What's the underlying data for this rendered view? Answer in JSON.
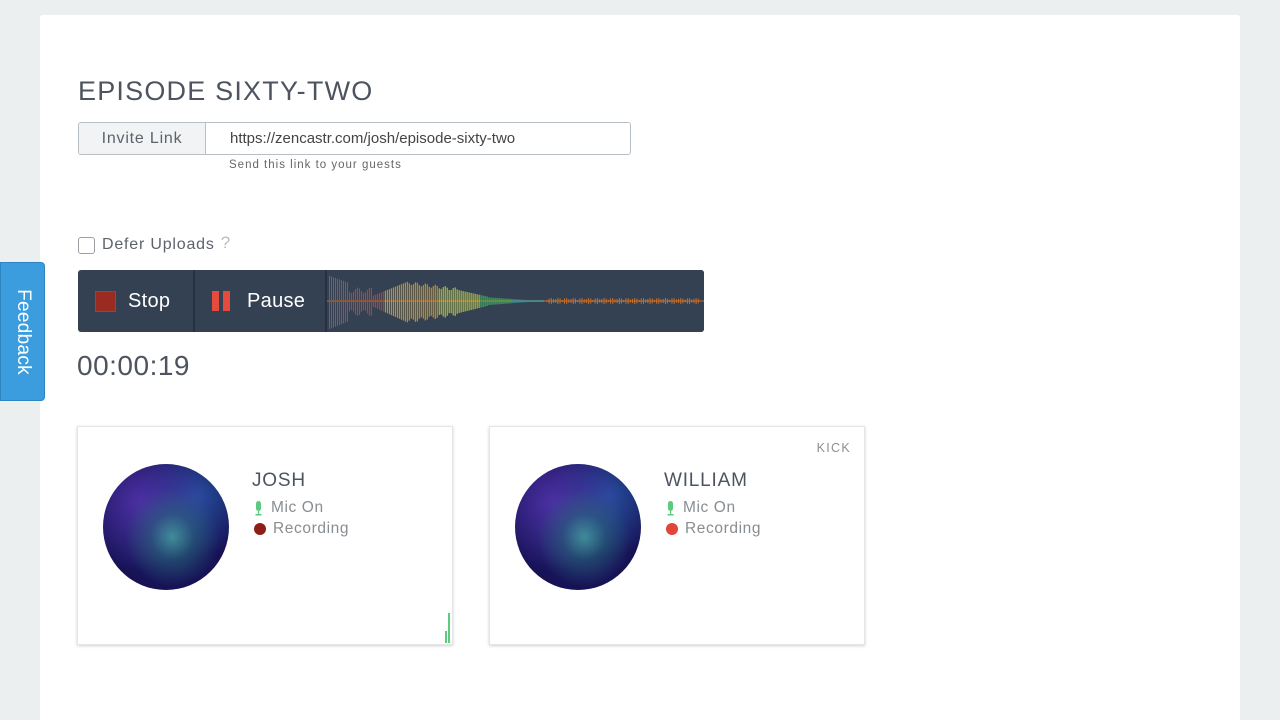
{
  "feedback": {
    "label": "Feedback"
  },
  "episode": {
    "title": "EPISODE SIXTY-TWO"
  },
  "invite": {
    "label": "Invite Link",
    "url": "https://zencastr.com/josh/episode-sixty-two",
    "hint": "Send this link to your guests"
  },
  "options": {
    "defer_label": "Defer Uploads",
    "defer_checked": false,
    "help": "?"
  },
  "controls": {
    "stop_label": "Stop",
    "pause_label": "Pause"
  },
  "timer": {
    "elapsed": "00:00:19"
  },
  "participants": [
    {
      "name": "JOSH",
      "mic_status": "Mic On",
      "rec_status": "Recording",
      "rec_color": "#8f1f16",
      "kick": ""
    },
    {
      "name": "WILLIAM",
      "mic_status": "Mic On",
      "rec_status": "Recording",
      "rec_color": "#e0443a",
      "kick": "KICK"
    }
  ],
  "colors": {
    "accent": "#3b9ddd",
    "toolbar": "#334152",
    "mic_on": "#5ccb7d",
    "stop": "#9a2b20",
    "pause": "#e54b3c"
  }
}
